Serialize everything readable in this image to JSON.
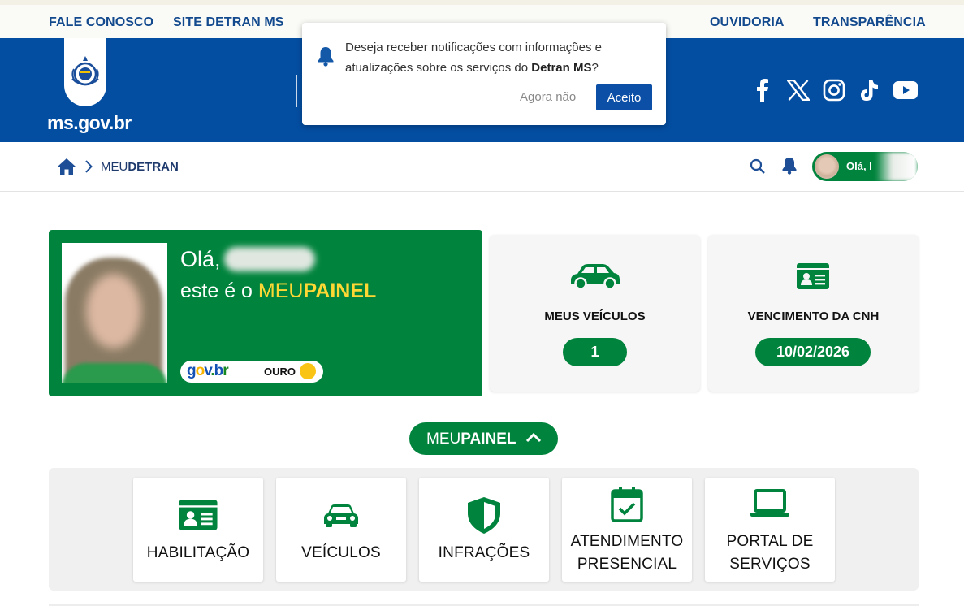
{
  "topbar": {
    "links": [
      "FALE CONOSCO",
      "SITE DETRAN MS",
      "OUVIDORIA",
      "TRANSPARÊNCIA"
    ]
  },
  "header": {
    "logo_text": "ms.gov.br",
    "social_icons": [
      "facebook-icon",
      "x-icon",
      "instagram-icon",
      "tiktok-icon",
      "youtube-icon"
    ]
  },
  "popup": {
    "message_line1": "Deseja receber notificações com informações e",
    "message_line2_prefix": "atualizações sobre os serviços do ",
    "message_brand": "Detran MS",
    "message_suffix": "?",
    "dismiss_label": "Agora não",
    "accept_label": "Aceito"
  },
  "breadcrumb": {
    "prefix": "MEU",
    "bold": "DETRAN"
  },
  "user": {
    "greeting": "Olá, I"
  },
  "hero": {
    "greeting": "Olá,",
    "line2_prefix": "este é o ",
    "brand_light": "MEU",
    "brand_bold": "PAINEL",
    "badge_text": "gov.br",
    "badge_level": "OURO"
  },
  "stats": [
    {
      "label": "MEUS VEÍCULOS",
      "value": "1",
      "icon": "car-icon"
    },
    {
      "label": "VENCIMENTO DA CNH",
      "value": "10/02/2026",
      "icon": "id-card-icon"
    }
  ],
  "panel_toggle": {
    "light": "MEU",
    "bold": "PAINEL"
  },
  "services": [
    {
      "line1": "HABILITAÇÃO",
      "line2": "",
      "icon": "id-card-icon"
    },
    {
      "line1": "VEÍCULOS",
      "line2": "",
      "icon": "car-icon"
    },
    {
      "line1": "INFRAÇÕES",
      "line2": "",
      "icon": "shield-icon"
    },
    {
      "line1": "ATENDIMENTO",
      "line2": "PRESENCIAL",
      "icon": "calendar-check-icon"
    },
    {
      "line1": "PORTAL DE",
      "line2": "SERVIÇOS",
      "icon": "laptop-icon"
    }
  ],
  "colors": {
    "header_blue": "#044ea2",
    "link_blue": "#134a8e",
    "green": "#00843d",
    "yellow": "#fdd835",
    "gold": "#f9c413"
  }
}
